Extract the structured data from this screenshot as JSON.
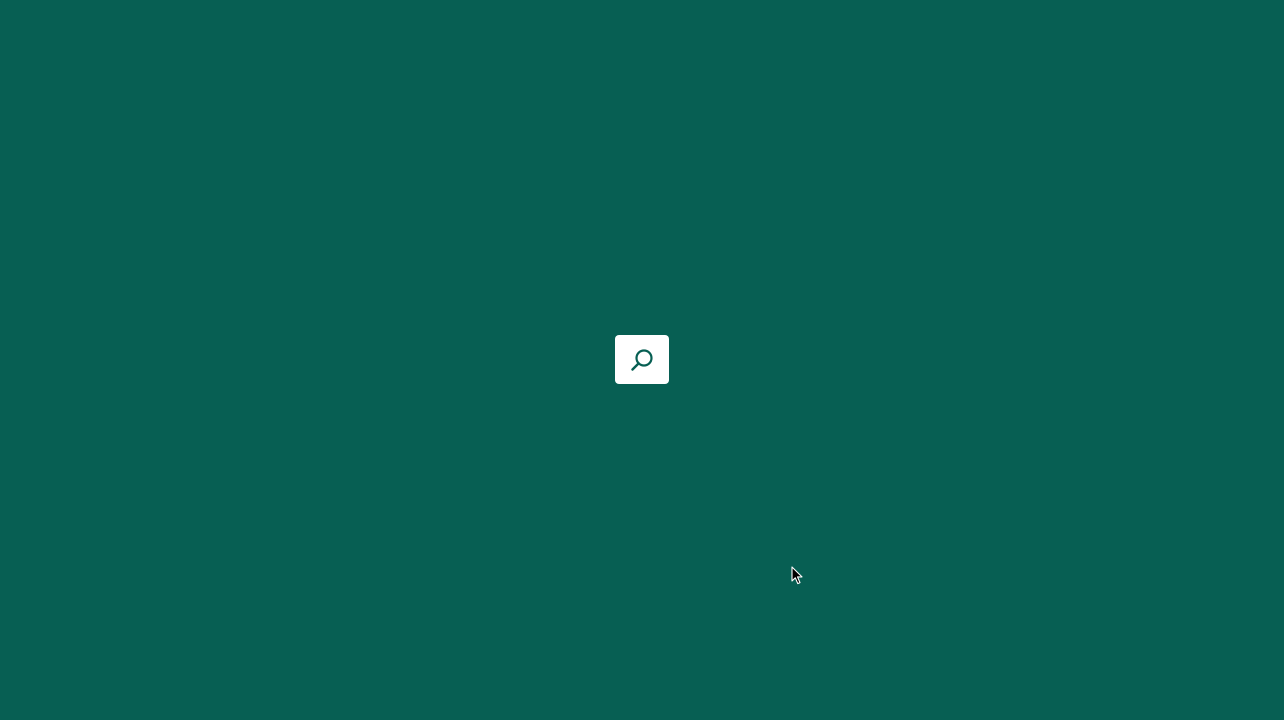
{
  "screen": {
    "background_color": "#075f53"
  },
  "search_launcher": {
    "icon": "search-icon",
    "background_color": "#ffffff",
    "icon_color": "#075f53"
  },
  "cursor": {
    "icon": "arrow-cursor-icon"
  }
}
